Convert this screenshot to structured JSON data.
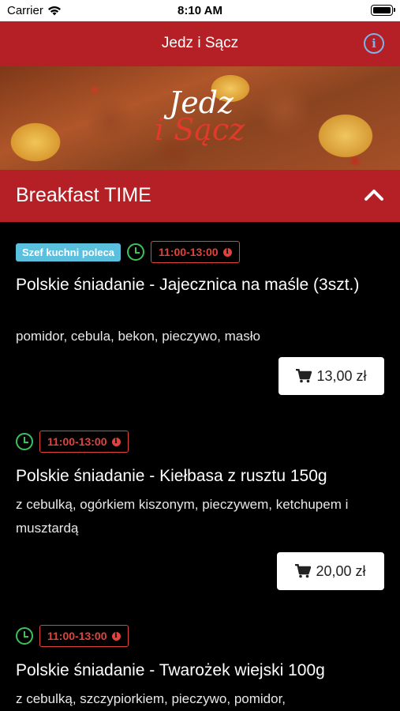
{
  "status_bar": {
    "carrier": "Carrier",
    "time": "8:10 AM"
  },
  "nav": {
    "title": "Jedz i Sącz",
    "info_glyph": "i"
  },
  "banner": {
    "logo_line1": "Jedz",
    "logo_line2": "i Sącz"
  },
  "section": {
    "title": "Breakfast TIME"
  },
  "items": [
    {
      "badge": "Szef kuchni poleca",
      "hours": "11:00-13:00",
      "title": "Polskie śniadanie - Jajecznica na maśle (3szt.)",
      "description": "pomidor, cebula, bekon, pieczywo, masło",
      "price": "13,00 zł"
    },
    {
      "hours": "11:00-13:00",
      "title": "Polskie śniadanie - Kiełbasa z rusztu 150g",
      "description": "z cebulką, ogórkiem kiszonym, pieczywem, ketchupem i musztardą",
      "price": "20,00 zł"
    },
    {
      "hours": "11:00-13:00",
      "title": "Polskie śniadanie - Twarożek wiejski 100g",
      "description": "z cebulką, szczypiorkiem, pieczywo, pomidor,"
    }
  ],
  "colors": {
    "brand_red": "#b42025",
    "badge_blue": "#5bc0de",
    "clock_green": "#3bc25b",
    "hours_red": "#e0433b",
    "info_blue": "#7db3e8"
  },
  "icons": {
    "wifi": "wifi-icon",
    "battery": "battery-icon",
    "info": "info-icon",
    "chevron": "chevron-up-icon",
    "clock": "clock-icon",
    "cart": "shopping-cart-icon"
  }
}
